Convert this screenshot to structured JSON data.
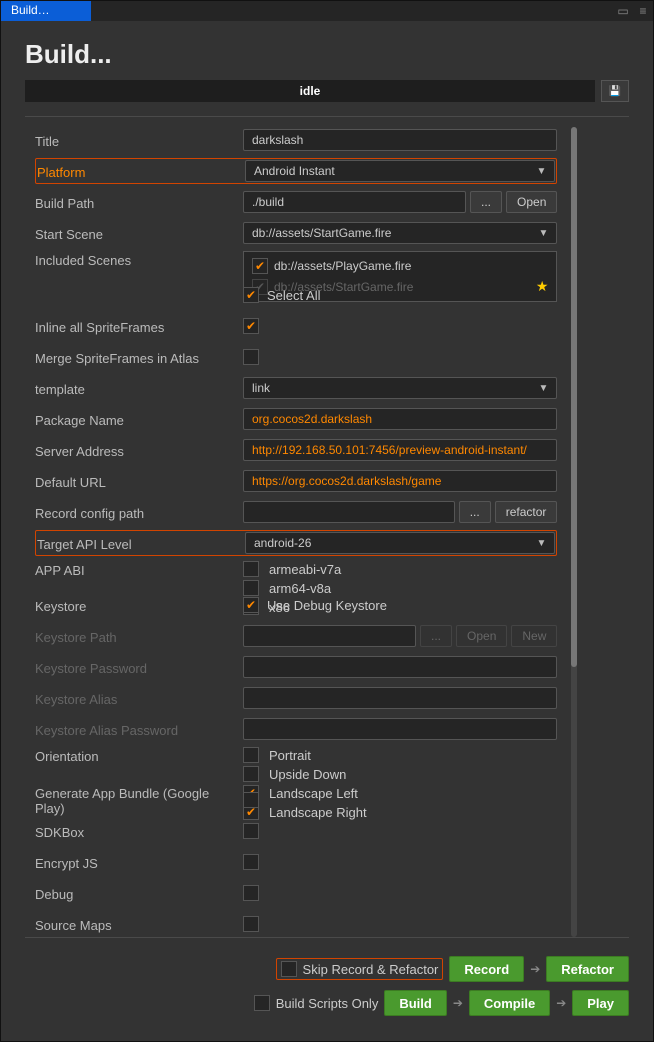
{
  "window": {
    "tab": "Build…",
    "title": "Build...",
    "status": "idle"
  },
  "labels": {
    "title": "Title",
    "platform": "Platform",
    "buildPath": "Build Path",
    "startScene": "Start Scene",
    "includedScenes": "Included Scenes",
    "inlineSprite": "Inline all SpriteFrames",
    "mergeSprite": "Merge SpriteFrames in Atlas",
    "template": "template",
    "packageName": "Package Name",
    "serverAddress": "Server Address",
    "defaultUrl": "Default URL",
    "recordConfig": "Record config path",
    "targetApi": "Target API Level",
    "appAbi": "APP ABI",
    "keystore": "Keystore",
    "keystorePath": "Keystore Path",
    "keystorePassword": "Keystore Password",
    "keystoreAlias": "Keystore Alias",
    "keystoreAliasPwd": "Keystore Alias Password",
    "orientation": "Orientation",
    "genBundle": "Generate App Bundle (Google Play)",
    "sdkbox": "SDKBox",
    "encryptJs": "Encrypt JS",
    "debug": "Debug",
    "sourceMaps": "Source Maps"
  },
  "values": {
    "title": "darkslash",
    "platform": "Android Instant",
    "buildPath": "./build",
    "startScene": "db://assets/StartGame.fire",
    "scene1": "db://assets/PlayGame.fire",
    "scene2": "db://assets/StartGame.fire",
    "selectAll": "Select All",
    "template": "link",
    "packageName": "org.cocos2d.darkslash",
    "serverAddress": "http://192.168.50.101:7456/preview-android-instant/",
    "defaultUrl": "https://org.cocos2d.darkslash/game",
    "targetApi": "android-26",
    "abi1": "armeabi-v7a",
    "abi2": "arm64-v8a",
    "abi3": "x86",
    "useDebugKeystore": "Use Debug Keystore",
    "orPortrait": "Portrait",
    "orUpside": "Upside Down",
    "orLandL": "Landscape Left",
    "orLandR": "Landscape Right"
  },
  "buttons": {
    "dots": "...",
    "open": "Open",
    "refactor": "refactor",
    "new": "New",
    "skipRecord": "Skip Record & Refactor",
    "record": "Record",
    "refactorBig": "Refactor",
    "buildScriptsOnly": "Build Scripts Only",
    "build": "Build",
    "compile": "Compile",
    "play": "Play"
  }
}
